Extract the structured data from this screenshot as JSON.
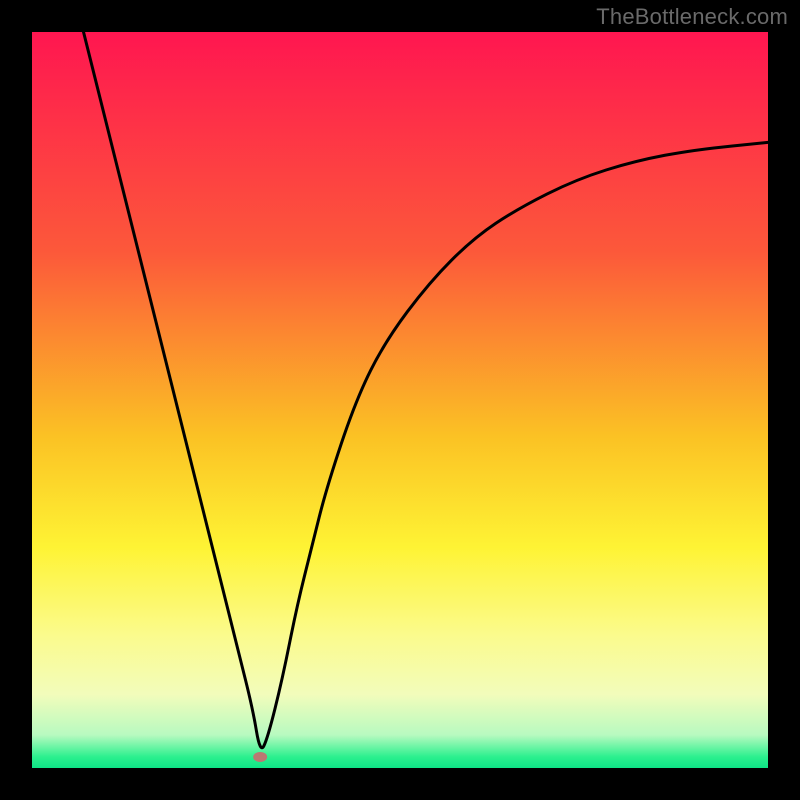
{
  "watermark": "TheBottleneck.com",
  "chart_data": {
    "type": "line",
    "title": "",
    "xlabel": "",
    "ylabel": "",
    "xlim": [
      0,
      100
    ],
    "ylim": [
      0,
      100
    ],
    "grid": false,
    "legend": false,
    "annotations": [],
    "background_gradient": [
      {
        "pos": 0.0,
        "color": "#ff1650"
      },
      {
        "pos": 0.3,
        "color": "#fc593a"
      },
      {
        "pos": 0.55,
        "color": "#fbc224"
      },
      {
        "pos": 0.7,
        "color": "#fef334"
      },
      {
        "pos": 0.82,
        "color": "#fbfb8d"
      },
      {
        "pos": 0.9,
        "color": "#f2fcbb"
      },
      {
        "pos": 0.955,
        "color": "#b8fac0"
      },
      {
        "pos": 0.985,
        "color": "#2bf08e"
      },
      {
        "pos": 1.0,
        "color": "#0ee486"
      }
    ],
    "marker": {
      "x": 31,
      "y": 1.5,
      "color": "#bb7872",
      "rx": 7,
      "ry": 5
    },
    "series": [
      {
        "name": "bottleneck-curve",
        "color": "#000000",
        "x": [
          7,
          10,
          14,
          18,
          22,
          26,
          28,
          30,
          31,
          32,
          34,
          36,
          38,
          40,
          44,
          48,
          54,
          60,
          66,
          74,
          82,
          90,
          100
        ],
        "y": [
          100,
          88,
          72,
          56,
          40,
          24,
          16,
          8,
          2,
          4,
          12,
          22,
          30,
          38,
          50,
          58,
          66,
          72,
          76,
          80,
          82.5,
          84,
          85
        ]
      }
    ]
  }
}
